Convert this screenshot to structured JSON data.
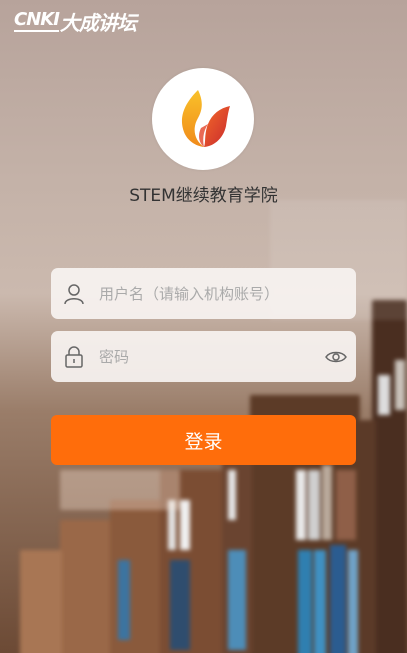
{
  "brand": {
    "prefix": "CNKI",
    "name": "大成讲坛"
  },
  "app": {
    "title": "STEM继续教育学院"
  },
  "login": {
    "username_placeholder": "用户名（请输入机构账号）",
    "username_value": "",
    "password_placeholder": "密码",
    "password_value": "",
    "submit_label": "登录"
  },
  "icons": {
    "user": "user-icon",
    "lock": "lock-icon",
    "eye": "eye-icon",
    "logo": "flame-logo-icon"
  },
  "colors": {
    "accent": "#ff6d0b",
    "logo_orange": "#f7a21b",
    "logo_red": "#e3452b"
  }
}
